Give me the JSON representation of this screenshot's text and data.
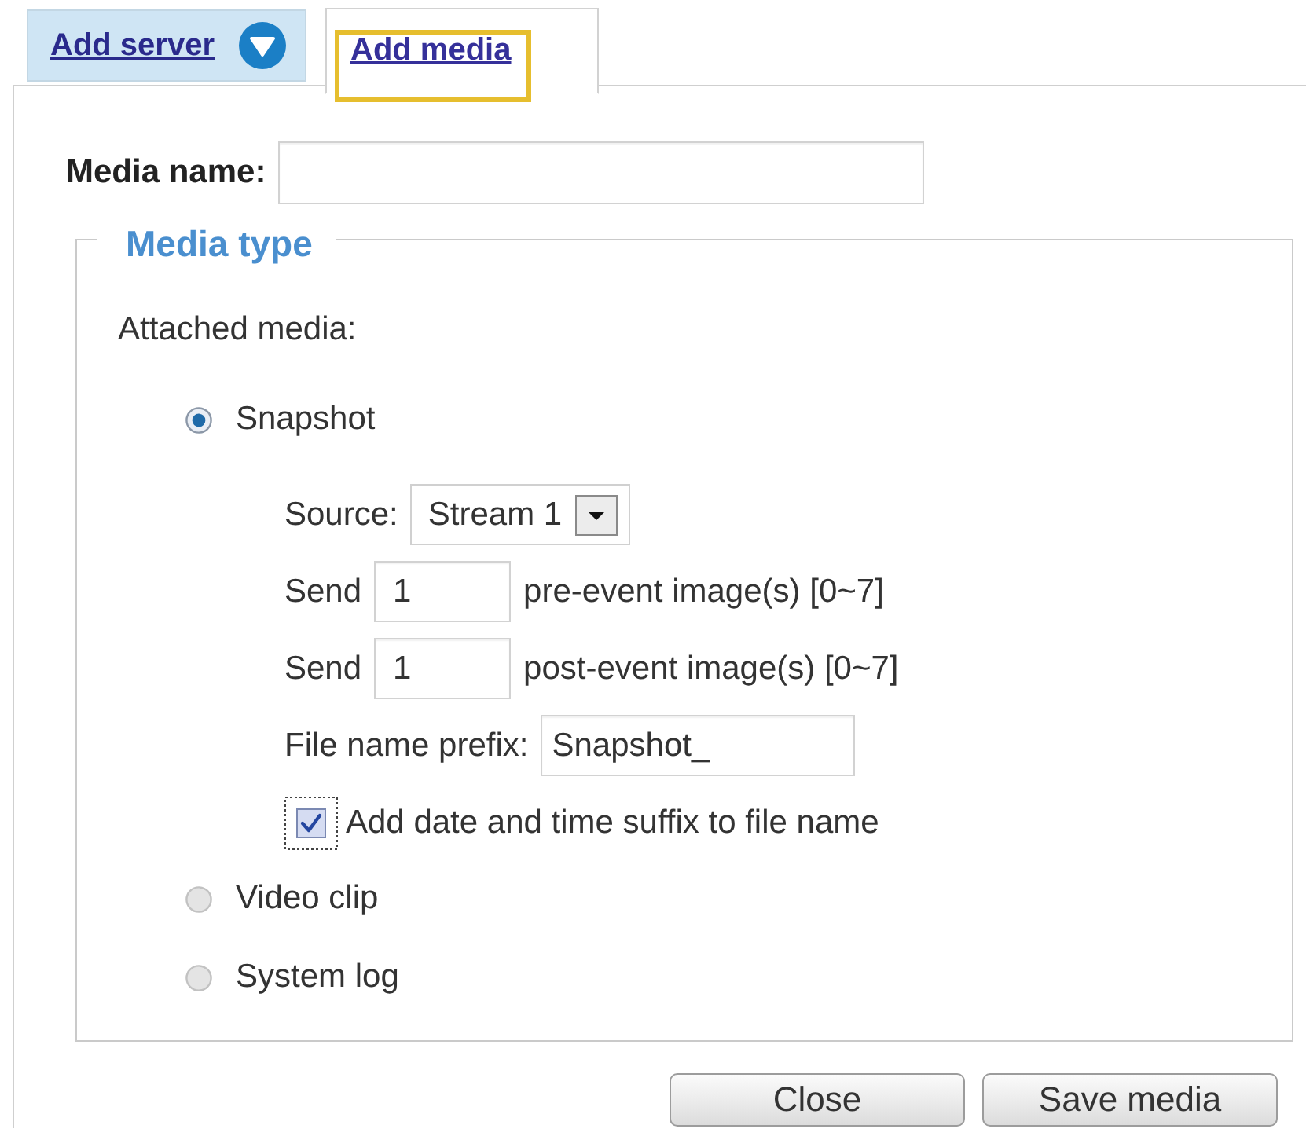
{
  "tabs": [
    {
      "label": "Add server",
      "kind": "menu",
      "selected": false,
      "highlighted": false
    },
    {
      "label": "Add media",
      "kind": "plain",
      "selected": true,
      "highlighted": true
    }
  ],
  "media_name": {
    "label": "Media name:"
  },
  "media_type": {
    "legend": "Media type",
    "prompt": "Attached media:",
    "options": [
      {
        "label": "Snapshot",
        "selected": true,
        "settings": {
          "source": {
            "label": "Source:",
            "value": "Stream 1"
          },
          "send": [
            {
              "label": "Send",
              "value": "1",
              "note": "pre-event image(s) [0~7]"
            },
            {
              "label": "Send",
              "value": "1",
              "note": "post-event image(s) [0~7]"
            }
          ],
          "prefix": {
            "label": "File name prefix:",
            "value": "Snapshot_"
          },
          "suffix": {
            "label": "Add date and time suffix to file name",
            "checked": true,
            "focused": true
          }
        }
      },
      {
        "label": "Video clip",
        "selected": false
      },
      {
        "label": "System log",
        "selected": false
      }
    ]
  },
  "buttons": [
    {
      "label": "Close"
    },
    {
      "label": "Save media"
    }
  ]
}
